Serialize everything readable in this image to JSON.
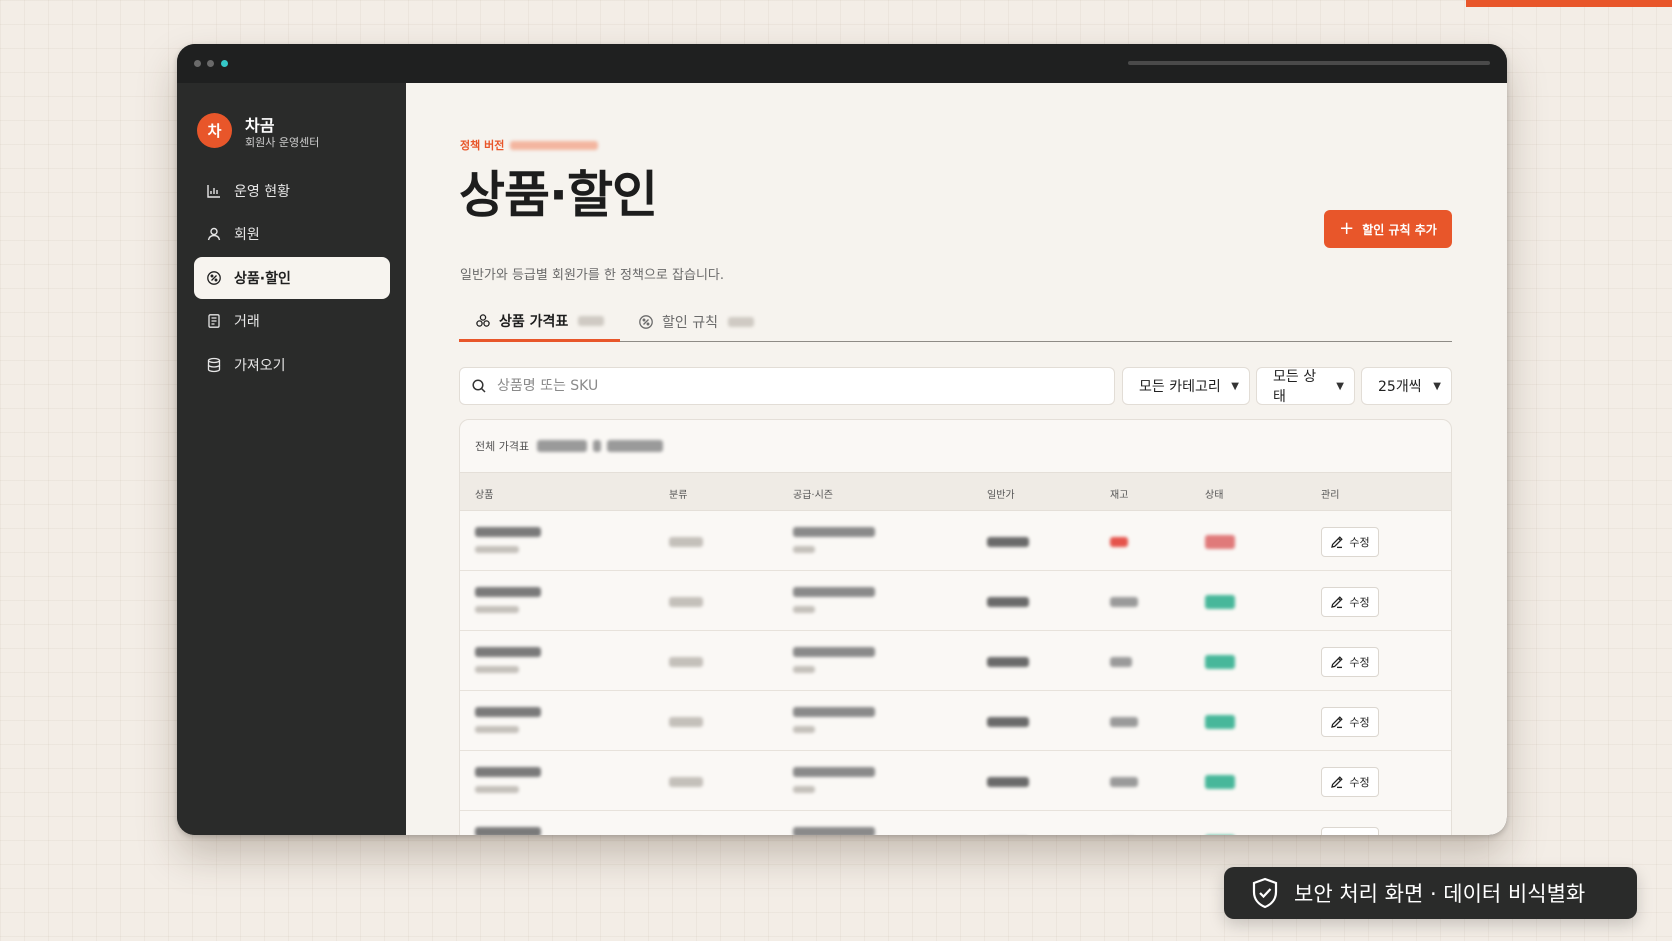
{
  "sidebar": {
    "brand": {
      "avatar": "차",
      "name": "차곰",
      "subtitle": "회원사 운영센터"
    },
    "items": [
      {
        "label": "운영 현황",
        "icon": "bar-chart-icon",
        "active": false
      },
      {
        "label": "회원",
        "icon": "user-icon",
        "active": false
      },
      {
        "label": "상품·할인",
        "icon": "discount-badge-icon",
        "active": true
      },
      {
        "label": "거래",
        "icon": "receipt-icon",
        "active": false
      },
      {
        "label": "가져오기",
        "icon": "database-icon",
        "active": false
      }
    ]
  },
  "header": {
    "eyebrow": "정책 버전",
    "title": "상품·할인",
    "description": "일반가와 등급별 회원가를 한 정책으로 잡습니다.",
    "add_button": "할인 규칙 추가"
  },
  "tabs": [
    {
      "label": "상품 가격표",
      "icon": "boxes-icon",
      "active": true
    },
    {
      "label": "할인 규칙",
      "icon": "discount-badge-icon",
      "active": false
    }
  ],
  "filters": {
    "search_placeholder": "상품명 또는 SKU",
    "category": "모든 카테고리",
    "status": "모든 상태",
    "page_size": "25개씩"
  },
  "table": {
    "title": "전체 가격표",
    "columns": [
      "상품",
      "분류",
      "공급·시즌",
      "일반가",
      "재고",
      "상태",
      "관리"
    ],
    "edit_label": "수정",
    "rows": [
      {
        "stock_state": "low",
        "status_state": "warn"
      },
      {
        "stock_state": "normal",
        "status_state": "ok"
      },
      {
        "stock_state": "normal",
        "status_state": "ok"
      },
      {
        "stock_state": "normal",
        "status_state": "ok"
      },
      {
        "stock_state": "normal",
        "status_state": "ok"
      },
      {
        "stock_state": "normal",
        "status_state": "ok"
      }
    ]
  },
  "badge": {
    "label": "보안 처리 화면 · 데이터 비식별화",
    "icon": "shield-check-icon"
  },
  "colors": {
    "accent": "#e8562a",
    "sidebar_bg": "#2a2b2a",
    "main_bg": "#f6f3ee",
    "status_ok": "#48b79a",
    "status_warn": "#e07a7a"
  }
}
